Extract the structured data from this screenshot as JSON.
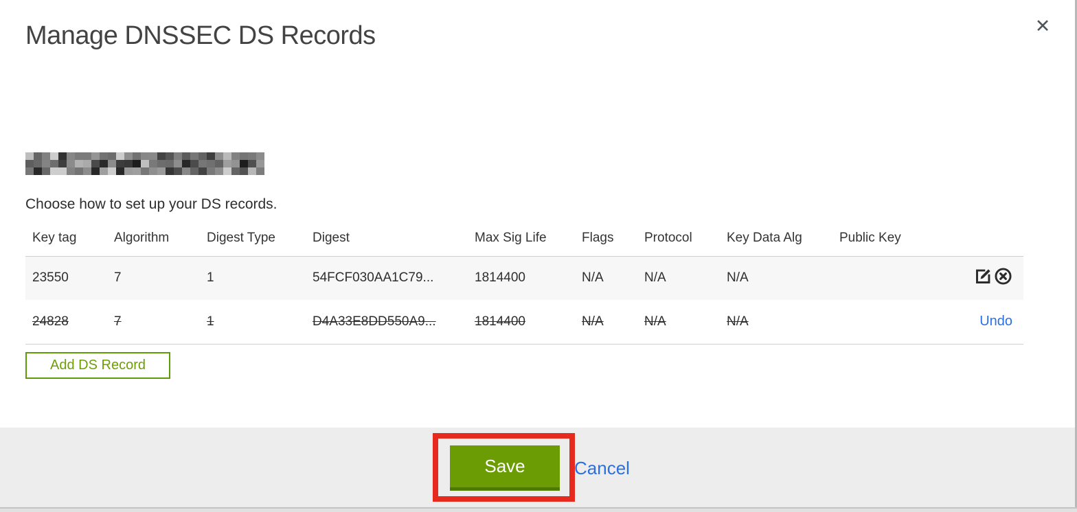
{
  "header": {
    "title": "Manage DNSSEC DS Records",
    "close_icon": "✕"
  },
  "intro": {
    "domain_pixelated": true,
    "subtitle": "Choose how to set up your DS records."
  },
  "table": {
    "columns": [
      "Key tag",
      "Algorithm",
      "Digest Type",
      "Digest",
      "Max Sig Life",
      "Flags",
      "Protocol",
      "Key Data Alg",
      "Public Key"
    ],
    "rows": [
      {
        "key_tag": "23550",
        "algorithm": "7",
        "digest_type": "1",
        "digest": "54FCF030AA1C79...",
        "max_sig_life": "1814400",
        "flags": "N/A",
        "protocol": "N/A",
        "key_data_alg": "N/A",
        "public_key": "",
        "state": "normal",
        "actions": [
          "edit-icon",
          "delete-icon"
        ]
      },
      {
        "key_tag": "24828",
        "algorithm": "7",
        "digest_type": "1",
        "digest": "D4A33E8DD550A9...",
        "max_sig_life": "1814400",
        "flags": "N/A",
        "protocol": "N/A",
        "key_data_alg": "N/A",
        "public_key": "",
        "state": "deleted",
        "undo_label": "Undo"
      }
    ]
  },
  "buttons": {
    "add_ds_record": "Add DS Record",
    "save": "Save",
    "cancel": "Cancel"
  },
  "icons": {
    "close": "x-cross",
    "edit": "pencil-on-square",
    "delete": "x-in-circle"
  },
  "annotation": {
    "highlight_shape": "red-rectangle-around-save-button",
    "highlight_color": "#e62b1e"
  },
  "colors": {
    "primary_green": "#6b9c04",
    "green_border": "#5f9a07",
    "link_blue": "#2b70e0",
    "footer_gray": "#ededed",
    "row_stripe": "#f7f7f7"
  }
}
